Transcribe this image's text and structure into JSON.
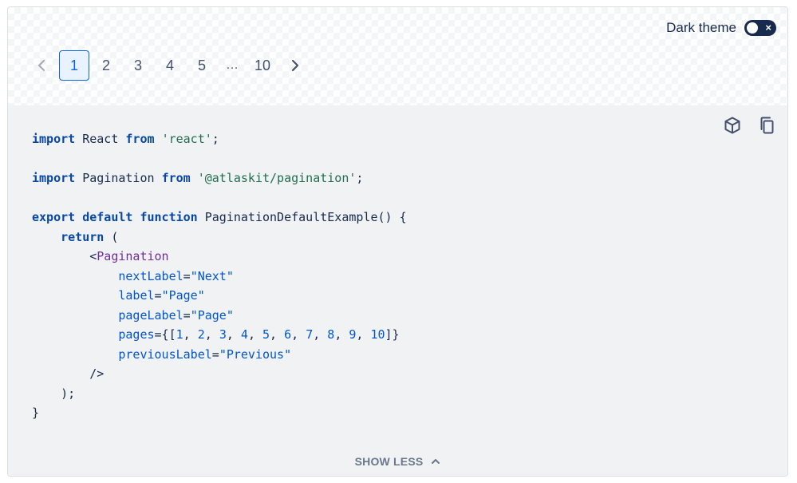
{
  "preview": {
    "dark_theme_label": "Dark theme",
    "toggle_icon": "×",
    "pagination": {
      "prev_icon": "chevron-left-icon",
      "next_icon": "chevron-right-icon",
      "pages": [
        "1",
        "2",
        "3",
        "4",
        "5"
      ],
      "ellipsis": "…",
      "last_page": "10",
      "selected": "1"
    }
  },
  "code": {
    "l1": {
      "kw": "import",
      "mid": " React ",
      "kw2": "from",
      "str": "'react'",
      "end": ";"
    },
    "l2": {
      "kw": "import",
      "mid": " Pagination ",
      "kw2": "from",
      "str": "'@atlaskit/pagination'",
      "end": ";"
    },
    "l3": {
      "kw": "export default function",
      "rest": " PaginationDefaultExample() {"
    },
    "l4": {
      "kw": "return",
      "rest": " ("
    },
    "l5": {
      "lt": "<",
      "tag": "Pagination"
    },
    "l6": {
      "attr": "nextLabel",
      "eq": "=",
      "str": "\"Next\""
    },
    "l7": {
      "attr": "label",
      "eq": "=",
      "str": "\"Page\""
    },
    "l8": {
      "attr": "pageLabel",
      "eq": "=",
      "str": "\"Page\""
    },
    "l9": {
      "attr": "pages",
      "pre": "={[",
      "nums": [
        "1",
        "2",
        "3",
        "4",
        "5",
        "6",
        "7",
        "8",
        "9",
        "10"
      ],
      "post": "]}"
    },
    "l10": {
      "attr": "previousLabel",
      "eq": "=",
      "str": "\"Previous\""
    },
    "l11": "/>",
    "l12": ");",
    "l13": "}"
  },
  "toolbar": {
    "sandbox_icon": "cube-icon",
    "copy_icon": "copy-icon"
  },
  "footer": {
    "show_less_label": "SHOW LESS",
    "chevron_icon": "chevron-up-icon"
  }
}
